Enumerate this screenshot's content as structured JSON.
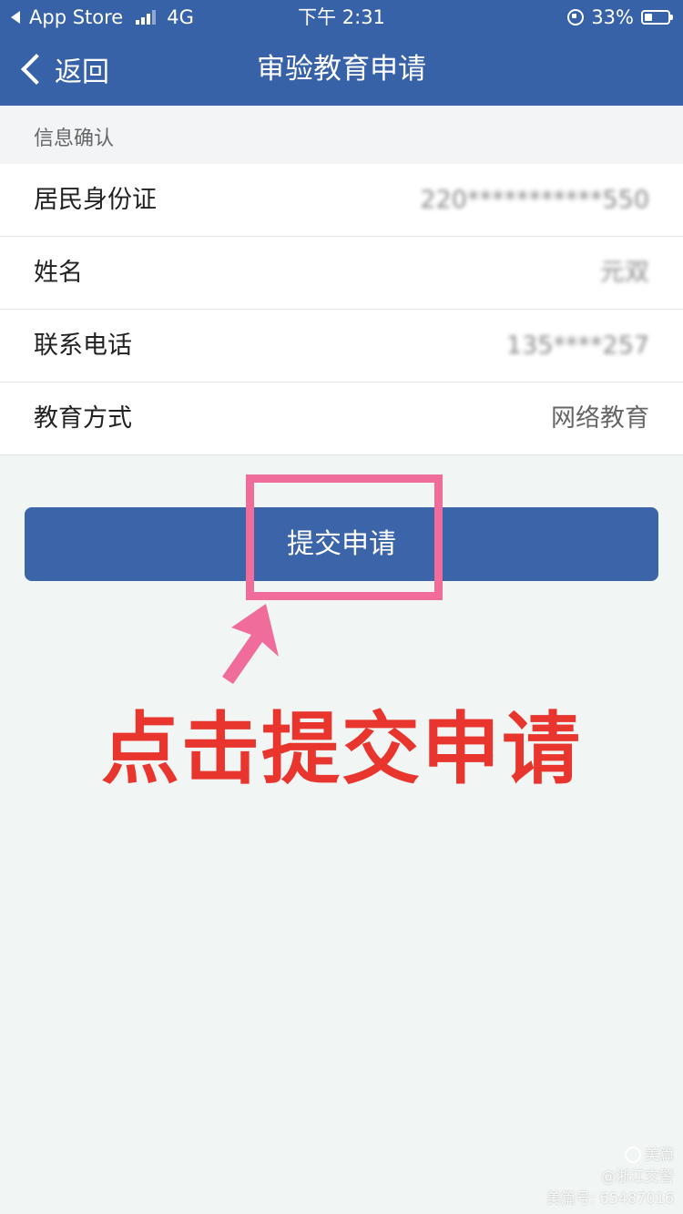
{
  "status_bar": {
    "carrier": "App Store",
    "network": "4G",
    "time": "下午 2:31",
    "battery": "33%"
  },
  "nav": {
    "back_label": "返回",
    "title": "审验教育申请"
  },
  "section": {
    "header": "信息确认"
  },
  "info_rows": [
    {
      "label": "居民身份证",
      "value": "220***********550"
    },
    {
      "label": "姓名",
      "value": "元双"
    },
    {
      "label": "联系电话",
      "value": "135****257"
    },
    {
      "label": "教育方式",
      "value": "网络教育"
    }
  ],
  "submit": {
    "label": "提交申请"
  },
  "annotation": {
    "text": "点击提交申请",
    "color": "#e8362f",
    "highlight_color": "#ef6c9b"
  },
  "watermark": {
    "brand": "美篇",
    "line2": "@浙江交警",
    "line3": "美篇号: 65487016"
  },
  "theme": {
    "primary": "#3862a8",
    "background": "#f1f5f4"
  }
}
